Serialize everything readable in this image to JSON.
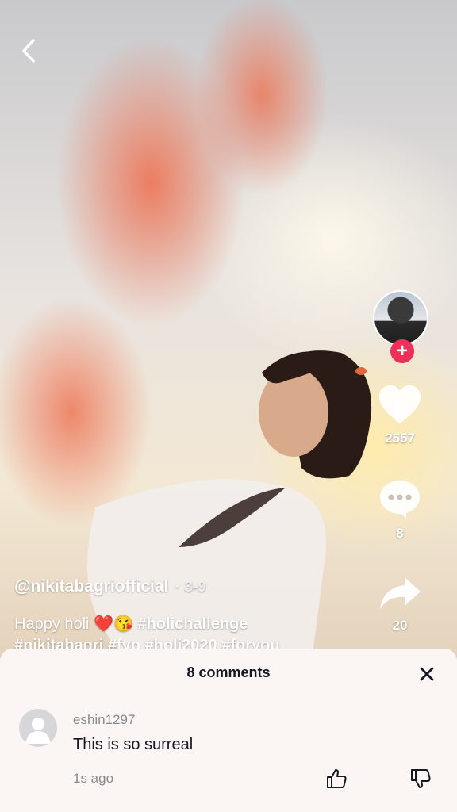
{
  "video": {
    "author_handle": "@nikitabagriofficial",
    "date": "· 3-9",
    "caption_text": "Happy holi",
    "caption_emojis": "❤️😘",
    "caption_hashtag": "#holichallenge",
    "hashtags_line2": "#nikitabagri #fyp #holi2020 #foryou"
  },
  "actions": {
    "likes": "2557",
    "comments": "8",
    "shares": "20"
  },
  "comments_sheet": {
    "title": "8 comments",
    "items": [
      {
        "username": "eshin1297",
        "text": "This is so surreal",
        "time": "1s ago"
      }
    ]
  },
  "icons": {
    "back": "chevron-left-icon",
    "like": "heart-icon",
    "comment": "speech-bubble-icon",
    "share": "share-arrow-icon",
    "follow": "plus-icon",
    "close": "close-icon",
    "comment_like": "thumbs-up-icon",
    "comment_dislike": "thumbs-down-icon"
  },
  "colors": {
    "follow_red": "#ee2f57",
    "sheet_bg": "#fbf5f3"
  }
}
